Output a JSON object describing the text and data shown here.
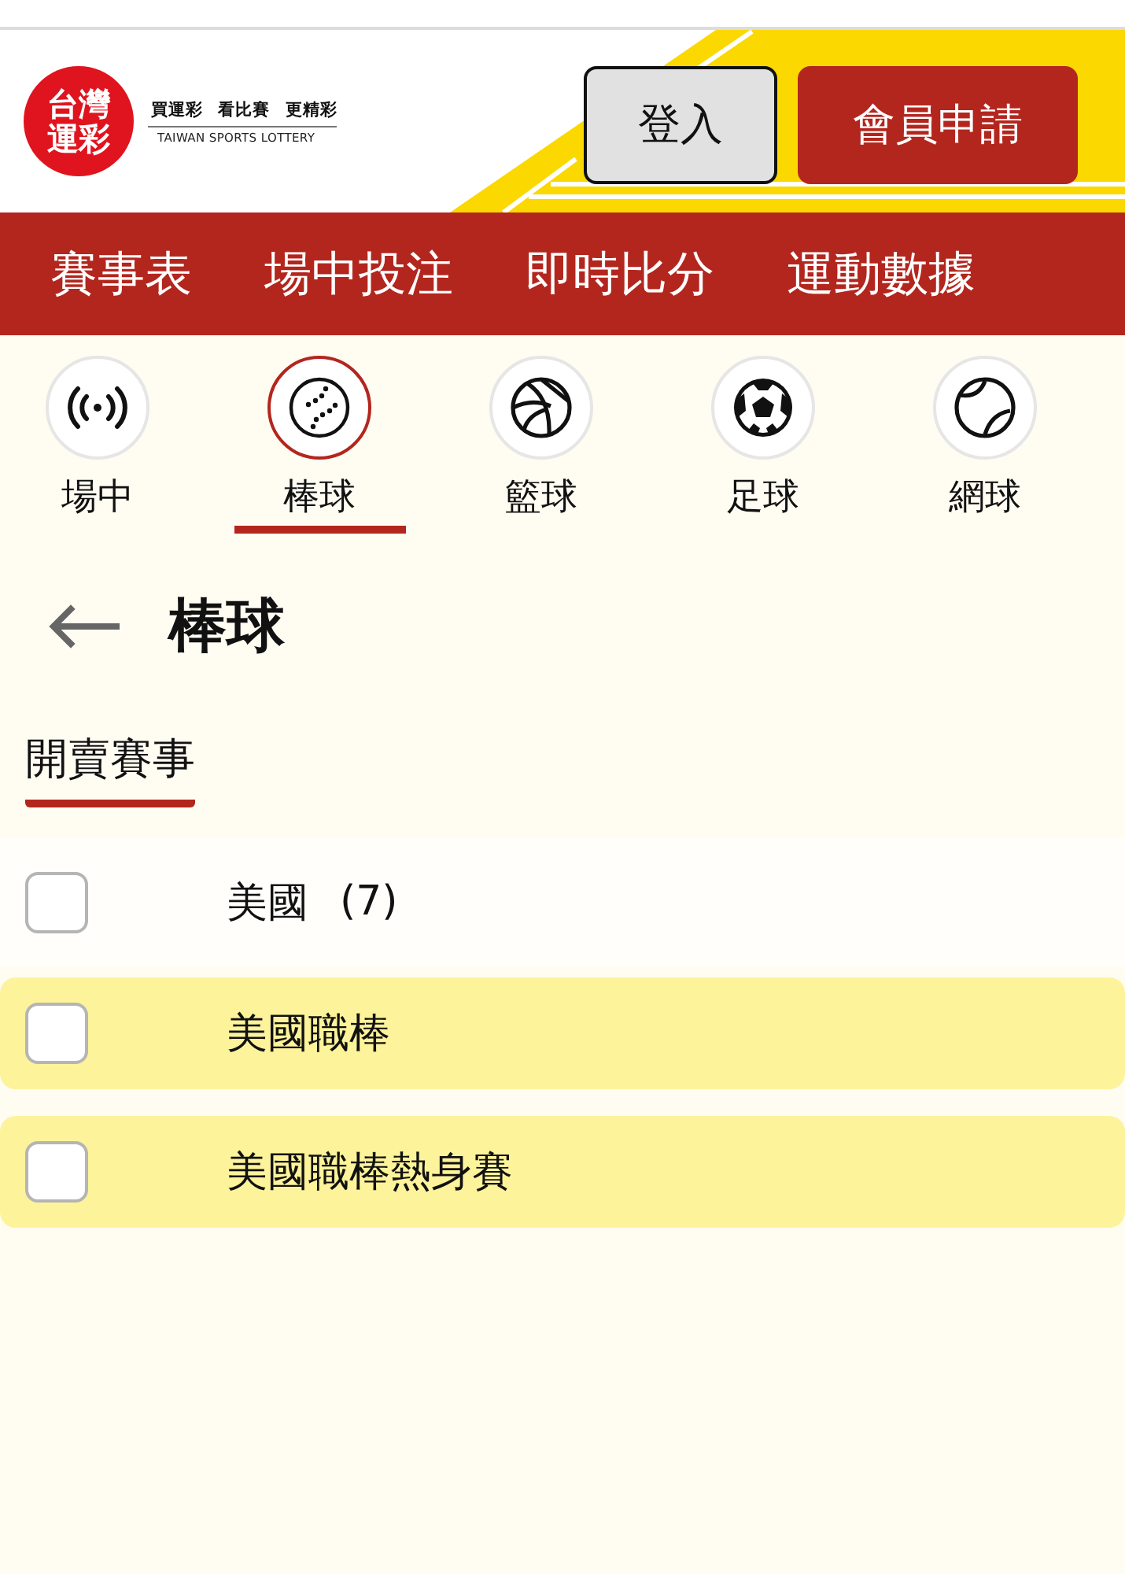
{
  "header": {
    "logo_text": "台灣運彩",
    "tagline": "買運彩 看比賽 更精彩",
    "tagline_en": "TAIWAN SPORTS LOTTERY",
    "login_button": "登入",
    "register_button": "會員申請"
  },
  "nav": [
    "賽事表",
    "場中投注",
    "即時比分",
    "運動數據"
  ],
  "sports": [
    {
      "kind": "live",
      "label": "場中",
      "selected": false
    },
    {
      "kind": "baseball",
      "label": "棒球",
      "selected": true
    },
    {
      "kind": "basketball",
      "label": "籃球",
      "selected": false
    },
    {
      "kind": "soccer",
      "label": "足球",
      "selected": false
    },
    {
      "kind": "tennis",
      "label": "網球",
      "selected": false
    }
  ],
  "page": {
    "title": "棒球"
  },
  "section_tab": {
    "label": "開賣賽事",
    "selected": true
  },
  "rows": [
    {
      "kind": "country",
      "name": "美國",
      "count": "(7)",
      "checked": false
    },
    {
      "kind": "league",
      "name": "美國職棒",
      "checked": false
    },
    {
      "kind": "league",
      "name": "美國職棒熱身賽",
      "checked": false
    }
  ]
}
